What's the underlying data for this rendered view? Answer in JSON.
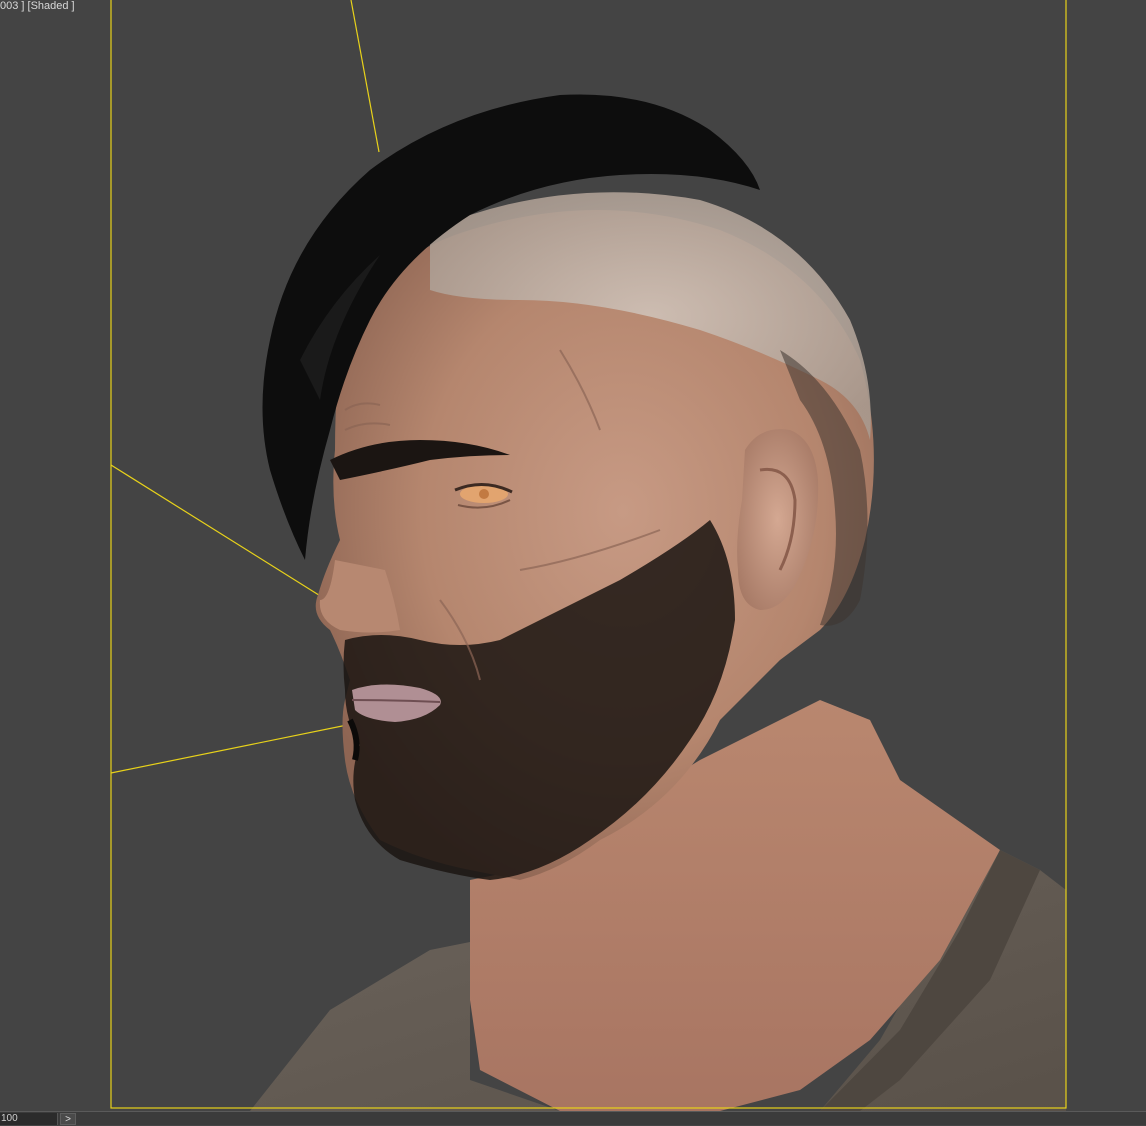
{
  "viewport": {
    "label": "003 ] [Shaded ]",
    "shading_mode": "Shaded",
    "background_color": "#444444",
    "safe_frame_color": "#e8d21a",
    "light_line_color": "#e8d21a"
  },
  "bottom_bar": {
    "frame_value": "100",
    "next_label": ">"
  }
}
